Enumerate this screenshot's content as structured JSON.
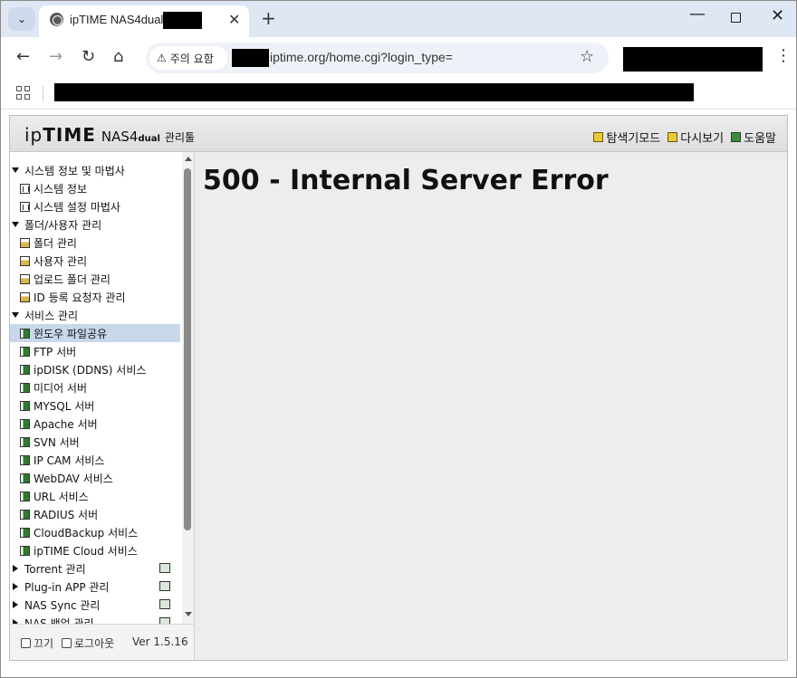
{
  "browser": {
    "tab_title": "ipTIME NAS4dual -",
    "url_chip": "주의 요함",
    "url": "iptime.org/home.cgi?login_type=",
    "icons": {
      "favicon": "globe-icon",
      "back": "back-arrow-icon",
      "forward": "forward-arrow-icon",
      "reload": "reload-icon",
      "home": "home-icon",
      "warning": "warning-icon",
      "bookmark": "star-icon",
      "menu": "kebab-menu-icon",
      "apps": "apps-grid-icon"
    }
  },
  "header": {
    "brand_ip": "ip",
    "brand_time": "TIME",
    "brand_model": "NAS4",
    "brand_dual": "dual",
    "brand_tool": "관리툴",
    "links": [
      "탐색기모드",
      "다시보기",
      "도움말"
    ]
  },
  "sidebar": {
    "items": [
      {
        "label": "시스템 정보 및 마법사",
        "type": "group-open"
      },
      {
        "label": "시스템 정보",
        "type": "leaf-chart"
      },
      {
        "label": "시스템 설정 마법사",
        "type": "leaf-chart"
      },
      {
        "label": "폴더/사용자 관리",
        "type": "group-open"
      },
      {
        "label": "폴더 관리",
        "type": "leaf-folder"
      },
      {
        "label": "사용자 관리",
        "type": "leaf-folder"
      },
      {
        "label": "업로드 폴더 관리",
        "type": "leaf-folder"
      },
      {
        "label": "ID 등록 요청자 관리",
        "type": "leaf-folder"
      },
      {
        "label": "서비스 관리",
        "type": "group-open"
      },
      {
        "label": "윈도우 파일공유",
        "type": "leaf-service",
        "selected": true
      },
      {
        "label": "FTP 서버",
        "type": "leaf-service"
      },
      {
        "label": "ipDISK (DDNS) 서비스",
        "type": "leaf-service"
      },
      {
        "label": "미디어 서버",
        "type": "leaf-service"
      },
      {
        "label": "MYSQL 서버",
        "type": "leaf-service"
      },
      {
        "label": "Apache 서버",
        "type": "leaf-service"
      },
      {
        "label": "SVN 서버",
        "type": "leaf-service"
      },
      {
        "label": "IP CAM 서비스",
        "type": "leaf-service"
      },
      {
        "label": "WebDAV 서비스",
        "type": "leaf-service"
      },
      {
        "label": "URL 서비스",
        "type": "leaf-service"
      },
      {
        "label": "RADIUS 서버",
        "type": "leaf-service"
      },
      {
        "label": "CloudBackup 서비스",
        "type": "leaf-service"
      },
      {
        "label": "ipTIME Cloud 서비스",
        "type": "leaf-service"
      },
      {
        "label": "Torrent 관리",
        "type": "group-closed"
      },
      {
        "label": "Plug-in APP 관리",
        "type": "group-closed"
      },
      {
        "label": "NAS Sync 관리",
        "type": "group-closed"
      },
      {
        "label": "NAS 백업 관리",
        "type": "group-closed"
      }
    ],
    "footer": {
      "power_label": "끄기",
      "logout_label": "로그아웃",
      "version": "Ver 1.5.16"
    }
  },
  "content": {
    "error_title": "500 - Internal Server Error"
  }
}
